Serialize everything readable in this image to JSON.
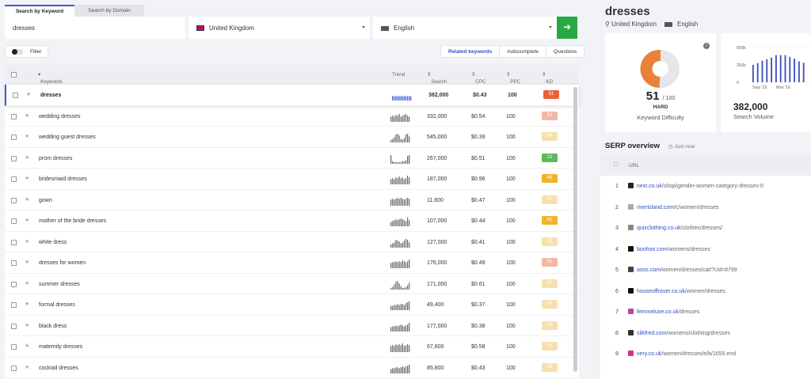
{
  "search_tabs": [
    "Search by Keyword",
    "Search by Domain"
  ],
  "search": {
    "keyword": "dresses",
    "location": "United Kingdom",
    "language": "English",
    "go_icon": "arrow-right-icon"
  },
  "filter": {
    "label": "Filter"
  },
  "subtabs": [
    "Related keywords",
    "Autocomplete",
    "Questions"
  ],
  "table": {
    "headers": {
      "keywords": "Keywords",
      "trend": "Trend",
      "search": "Search",
      "cpc": "CPC",
      "ppc": "PPC",
      "kd": "KD"
    },
    "rows": [
      {
        "keyword": "dresses",
        "search": "382,000",
        "cpc": "$0.43",
        "ppc": "100",
        "kd": "51",
        "kd_color": "#e8623c",
        "trend": [
          5,
          5,
          5,
          5,
          5,
          5,
          5,
          5,
          5,
          5,
          5,
          5
        ]
      },
      {
        "keyword": "wedding dresses",
        "search": "332,000",
        "cpc": "$0.54",
        "ppc": "100",
        "kd": "52",
        "kd_color": "#f2b7a4",
        "trend": [
          6,
          7,
          6,
          8,
          7,
          9,
          6,
          7,
          8,
          9,
          7,
          6
        ]
      },
      {
        "keyword": "wedding guest dresses",
        "search": "545,000",
        "cpc": "$0.39",
        "ppc": "100",
        "kd": "49",
        "kd_color": "#f8dfae",
        "trend": [
          3,
          4,
          6,
          9,
          10,
          8,
          4,
          3,
          5,
          9,
          10,
          7
        ]
      },
      {
        "keyword": "prom dresses",
        "search": "267,000",
        "cpc": "$0.51",
        "ppc": "100",
        "kd": "22",
        "kd_color": "#5cb85c",
        "trend": [
          10,
          3,
          2,
          2,
          2,
          2,
          2,
          3,
          3,
          4,
          9,
          10
        ]
      },
      {
        "keyword": "bridesmaid dresses",
        "search": "187,000",
        "cpc": "$0.96",
        "ppc": "100",
        "kd": "46",
        "kd_color": "#f0b429",
        "trend": [
          6,
          7,
          6,
          8,
          7,
          9,
          7,
          8,
          6,
          7,
          10,
          8
        ]
      },
      {
        "keyword": "gown",
        "search": "11,600",
        "cpc": "$0.47",
        "ppc": "100",
        "kd": "40",
        "kd_color": "#f8dfae",
        "trend": [
          7,
          8,
          7,
          8,
          9,
          8,
          9,
          8,
          7,
          8,
          9,
          8
        ]
      },
      {
        "keyword": "mother of the bride dresses",
        "search": "107,000",
        "cpc": "$0.44",
        "ppc": "100",
        "kd": "41",
        "kd_color": "#f0b429",
        "trend": [
          5,
          6,
          7,
          8,
          7,
          8,
          9,
          8,
          7,
          6,
          10,
          7
        ]
      },
      {
        "keyword": "white dress",
        "search": "127,000",
        "cpc": "$0.41",
        "ppc": "100",
        "kd": "37",
        "kd_color": "#f8dfae",
        "trend": [
          4,
          5,
          6,
          9,
          8,
          7,
          5,
          6,
          8,
          10,
          9,
          6
        ]
      },
      {
        "keyword": "dresses for women",
        "search": "176,000",
        "cpc": "$0.49",
        "ppc": "100",
        "kd": "51",
        "kd_color": "#f2b7a4",
        "trend": [
          6,
          7,
          7,
          8,
          7,
          8,
          7,
          9,
          8,
          7,
          8,
          10
        ]
      },
      {
        "keyword": "summer dresses",
        "search": "171,000",
        "cpc": "$0.61",
        "ppc": "100",
        "kd": "41",
        "kd_color": "#f8dfae",
        "trend": [
          2,
          3,
          6,
          9,
          10,
          7,
          4,
          2,
          2,
          3,
          5,
          8
        ]
      },
      {
        "keyword": "formal dresses",
        "search": "49,400",
        "cpc": "$0.37",
        "ppc": "100",
        "kd": "37",
        "kd_color": "#f8dfae",
        "trend": [
          5,
          5,
          6,
          6,
          7,
          6,
          7,
          7,
          6,
          8,
          9,
          10
        ]
      },
      {
        "keyword": "black dress",
        "search": "177,000",
        "cpc": "$0.38",
        "ppc": "100",
        "kd": "40",
        "kd_color": "#f8dfae",
        "trend": [
          5,
          6,
          6,
          7,
          6,
          7,
          8,
          7,
          6,
          7,
          8,
          10
        ]
      },
      {
        "keyword": "maternity dresses",
        "search": "67,800",
        "cpc": "$0.58",
        "ppc": "100",
        "kd": "41",
        "kd_color": "#f8dfae",
        "trend": [
          7,
          8,
          7,
          9,
          8,
          9,
          8,
          10,
          7,
          8,
          9,
          8
        ]
      },
      {
        "keyword": "cocktail dresses",
        "search": "85,800",
        "cpc": "$0.43",
        "ppc": "100",
        "kd": "36",
        "kd_color": "#f8dfae",
        "trend": [
          5,
          6,
          6,
          7,
          7,
          6,
          7,
          8,
          7,
          8,
          9,
          10
        ]
      }
    ]
  },
  "detail": {
    "keyword": "dresses",
    "location": "United Kingdom",
    "language": "English",
    "kd": {
      "value": "51",
      "max": "/ 100",
      "level": "HARD",
      "label": "Keyword Difficulty",
      "fraction": 0.51,
      "color": "#e8823a"
    },
    "volume": {
      "value": "382,000",
      "label": "Search Volume",
      "y_ticks": [
        "500k",
        "250k",
        "0"
      ],
      "x_ticks": [
        "Sep '15",
        "Mar '16"
      ],
      "bars": [
        0.5,
        0.55,
        0.62,
        0.66,
        0.71,
        0.78,
        0.78,
        0.78,
        0.73,
        0.68,
        0.6,
        0.56
      ]
    }
  },
  "serp": {
    "title": "SERP overview",
    "time": "Just now",
    "header_url": "URL",
    "rows": [
      {
        "n": "1",
        "domain": "next.co.uk",
        "path": "/shop/gender-women-category-dresses-0",
        "fav": "#222"
      },
      {
        "n": "2",
        "domain": "riverisland.com",
        "path": "/c/women/dresses",
        "fav": "#aaa"
      },
      {
        "n": "3",
        "domain": "quizclothing.co.uk",
        "path": "/clothes/dresses/",
        "fav": "#888"
      },
      {
        "n": "4",
        "domain": "boohoo.com",
        "path": "/womens/dresses",
        "fav": "#111"
      },
      {
        "n": "5",
        "domain": "asos.com",
        "path": "/women/dresses/cat/?cid=8799",
        "fav": "#444"
      },
      {
        "n": "6",
        "domain": "houseoffraser.co.uk",
        "path": "/women/dresses",
        "fav": "#111"
      },
      {
        "n": "7",
        "domain": "femmeluxe.co.uk",
        "path": "/dresses",
        "fav": "#b04aa8"
      },
      {
        "n": "8",
        "domain": "silkfred.com",
        "path": "/womens/clothing/dresses",
        "fav": "#333"
      },
      {
        "n": "9",
        "domain": "very.co.uk",
        "path": "/women/dresses/e/b/1655.end",
        "fav": "#d63384"
      }
    ]
  }
}
